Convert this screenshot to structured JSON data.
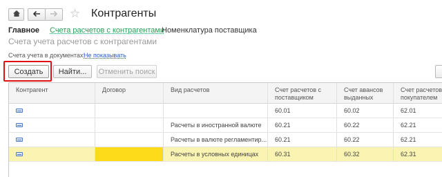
{
  "window": {
    "title": "Контрагенты"
  },
  "nav": {
    "home_icon": "home-icon",
    "back_icon": "arrow-left-icon",
    "forward_icon": "arrow-right-icon",
    "favorite_icon": "star-icon"
  },
  "tabs": [
    {
      "label": "Главное"
    },
    {
      "label": "Счета расчетов с контрагентами"
    },
    {
      "label": "Номенклатура поставщика"
    }
  ],
  "page": {
    "subtitle": "Счета учета расчетов с контрагентами",
    "accounts_label": "Счета учета в документах:",
    "accounts_value": "Не показывать"
  },
  "toolbar": {
    "create": "Создать",
    "find": "Найти...",
    "cancel_search": "Отменить поиск"
  },
  "table": {
    "columns": [
      "Контрагент",
      "Договор",
      "Вид расчетов",
      "Счет расчетов с поставщиком",
      "Счет авансов выданных",
      "Счет расчетов с покупателем"
    ],
    "rows": [
      {
        "kind": "",
        "c1": "60.01",
        "c2": "60.02",
        "c3": "62.01",
        "selected": false
      },
      {
        "kind": "Расчеты в иностранной валюте",
        "c1": "60.21",
        "c2": "60.22",
        "c3": "62.21",
        "selected": false
      },
      {
        "kind": "Расчеты в валюте регламентир...",
        "c1": "60.21",
        "c2": "60.22",
        "c3": "62.21",
        "selected": false
      },
      {
        "kind": "Расчеты в условных единицах",
        "c1": "60.31",
        "c2": "60.32",
        "c3": "62.31",
        "selected": true
      }
    ]
  },
  "colors": {
    "accent_link": "#2d9c54",
    "selected_row": "#faf3b2",
    "highlight_box": "#e01010",
    "contract_cell": "#fddb1a"
  }
}
